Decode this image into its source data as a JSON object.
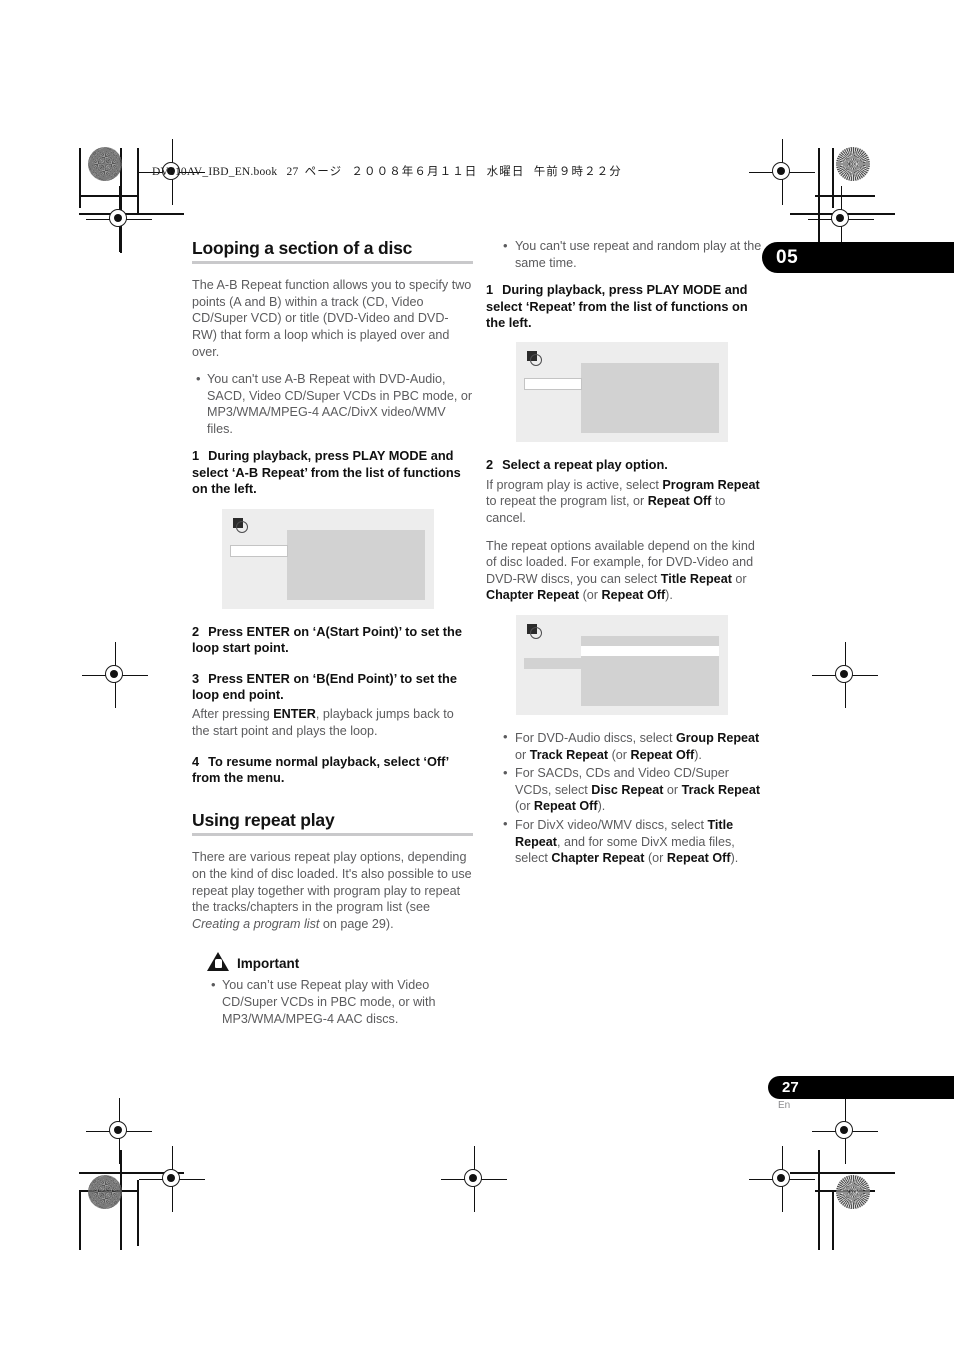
{
  "header": {
    "book_file": "DV610AV_IBD_EN.book",
    "page_label": "27",
    "page_unit": "ページ",
    "date": "２００８年６月１１日",
    "weekday": "水曜日",
    "time": "午前９時２２分"
  },
  "chapter_tab": {
    "number": "05"
  },
  "footer": {
    "page_number": "27",
    "language": "En"
  },
  "colors": {
    "body_text": "#5b5b5d",
    "heading": "#121212",
    "rule": "#c9c9cb",
    "tab_background": "#000000",
    "figure_outer": "#ededed",
    "figure_panel": "#d2d2d2",
    "figure_highlight": "#ffffff"
  },
  "left_column": {
    "heading": "Looping a section of a disc",
    "intro": "The A-B Repeat function allows you to specify two points (A and B) within a track (CD, Video CD/Super VCD) or title (DVD-Video and DVD-RW) that form a loop which is played over and over.",
    "intro_bullets": [
      "You can't use A-B Repeat with DVD-Audio, SACD, Video CD/Super VCDs in PBC mode, or MP3/WMA/MPEG-4 AAC/DivX video/WMV files."
    ],
    "step1": {
      "number": "1",
      "text": "During playback, press PLAY MODE and select ‘A-B Repeat’ from the list of functions on the left."
    },
    "figure1": {
      "icon": "disc-osd-icon"
    },
    "step2": {
      "number": "2",
      "text": "Press ENTER on ‘A(Start Point)’ to set the loop start point."
    },
    "step3": {
      "number": "3",
      "text": "Press ENTER on ‘B(End Point)’ to set the loop end point.",
      "note_pre": "After pressing ",
      "note_bold": "ENTER",
      "note_post": ", playback jumps back to the start point and plays the loop."
    },
    "step4": {
      "number": "4",
      "text": "To resume normal playback, select ‘Off’ from the menu."
    },
    "heading2": "Using repeat play",
    "repeat_intro_pre": "There are various repeat play options, depending on the kind of disc loaded. It's also possible to use repeat play together with program play to repeat the tracks/chapters in the program list (see ",
    "repeat_intro_italic": "Creating a program list",
    "repeat_intro_post": " on page 29).",
    "important": {
      "label": "Important",
      "icon": "warning-triangle-icon",
      "bullets": [
        "You can’t use Repeat play with Video CD/Super VCDs in PBC mode, or with MP3/WMA/MPEG-4 AAC discs."
      ]
    }
  },
  "right_column": {
    "top_bullets": [
      "You can't use repeat and random play at the same time."
    ],
    "step1": {
      "number": "1",
      "text": "During playback, press PLAY MODE and select ‘Repeat’ from the list of functions on the left."
    },
    "figure1": {
      "icon": "disc-osd-icon"
    },
    "step2": {
      "number": "2",
      "text": "Select a repeat play option."
    },
    "para1": {
      "a": "If program play is active, select ",
      "b1": "Program Repeat",
      "c": " to repeat the program list, or ",
      "b2": "Repeat Off",
      "d": " to cancel."
    },
    "para2": {
      "a": "The repeat options available depend on the kind of disc loaded. For example, for DVD-Video and DVD-RW discs, you can select ",
      "b1": "Title Repeat",
      "c": " or ",
      "b2": "Chapter Repeat",
      "d": " (or ",
      "b3": "Repeat Off",
      "e": ")."
    },
    "figure2": {
      "icon": "disc-osd-icon"
    },
    "disc_bullets": [
      {
        "a": "For DVD-Audio discs, select ",
        "b1": "Group Repeat",
        "c": " or ",
        "b2": "Track Repeat",
        "d": " (or ",
        "b3": "Repeat Off",
        "e": ")."
      },
      {
        "a": "For SACDs, CDs and Video CD/Super VCDs, select ",
        "b1": "Disc Repeat",
        "c": " or ",
        "b2": "Track Repeat",
        "d": " (or ",
        "b3": "Repeat Off",
        "e": ")."
      },
      {
        "a": "For DivX video/WMV discs, select ",
        "b1": "Title Repeat",
        "c": ", and for some DivX media files, select ",
        "b2": "Chapter Repeat",
        "d": " (or ",
        "b3": "Repeat Off",
        "e": ")."
      }
    ]
  }
}
